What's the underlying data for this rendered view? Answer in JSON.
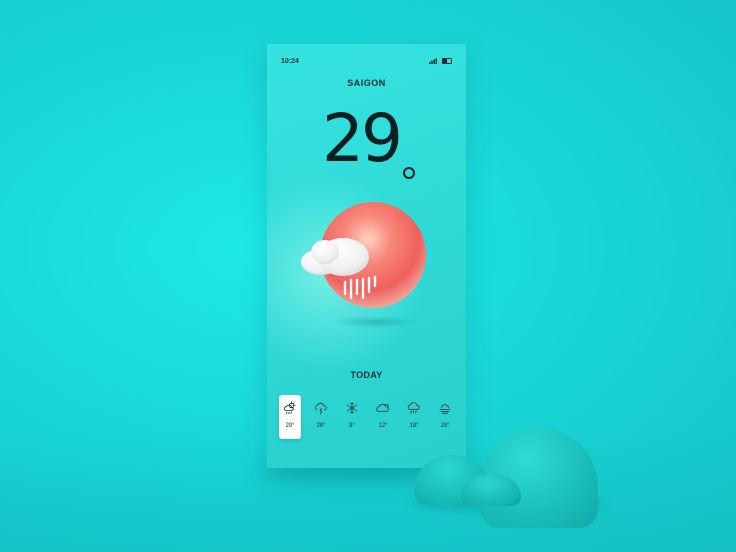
{
  "status_bar": {
    "time": "10:24",
    "signal_icon": "signal-icon",
    "battery_icon": "battery-icon"
  },
  "location": {
    "city": "SAIGON"
  },
  "current": {
    "temperature": "29",
    "icon": "sun-cloud-rain-icon"
  },
  "forecast": {
    "label": "TODAY",
    "items": [
      {
        "icon": "sun-cloud-rain-icon",
        "temp": "29°",
        "selected": true
      },
      {
        "icon": "cloud-lightning-icon",
        "temp": "28°",
        "selected": false
      },
      {
        "icon": "snowflake-icon",
        "temp": "9°",
        "selected": false
      },
      {
        "icon": "cloud-icon",
        "temp": "12°",
        "selected": false
      },
      {
        "icon": "cloud-rain-icon",
        "temp": "19°",
        "selected": false
      },
      {
        "icon": "sun-fog-icon",
        "temp": "29°",
        "selected": false
      }
    ]
  },
  "colors": {
    "background": "#19d7d8",
    "phone": "#2fd9d6",
    "text": "#0d2f33",
    "sun": "#f06b5e",
    "cloud": "#f4f4f4"
  }
}
